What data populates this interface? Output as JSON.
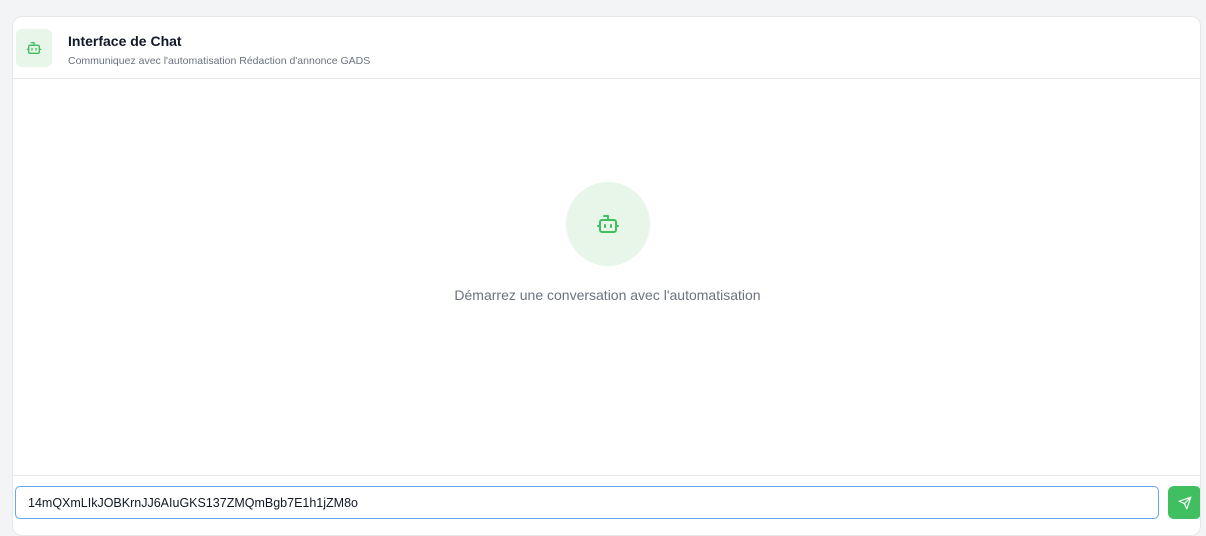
{
  "header": {
    "title": "Interface de Chat",
    "subtitle": "Communiquez avec l'automatisation Rédaction d'annonce GADS",
    "icon": "bot-icon"
  },
  "empty_state": {
    "icon": "bot-icon",
    "message": "Démarrez une conversation avec l'automatisation"
  },
  "composer": {
    "input_value": "14mQXmLIkJOBKrnJJ6AIuGKS137ZMQmBgb7E1h1jZM8o",
    "send_icon": "send-icon"
  },
  "colors": {
    "accent": "#3fbf5f",
    "accent_soft": "#e8f5e9",
    "input_focus": "#60a5fa"
  }
}
